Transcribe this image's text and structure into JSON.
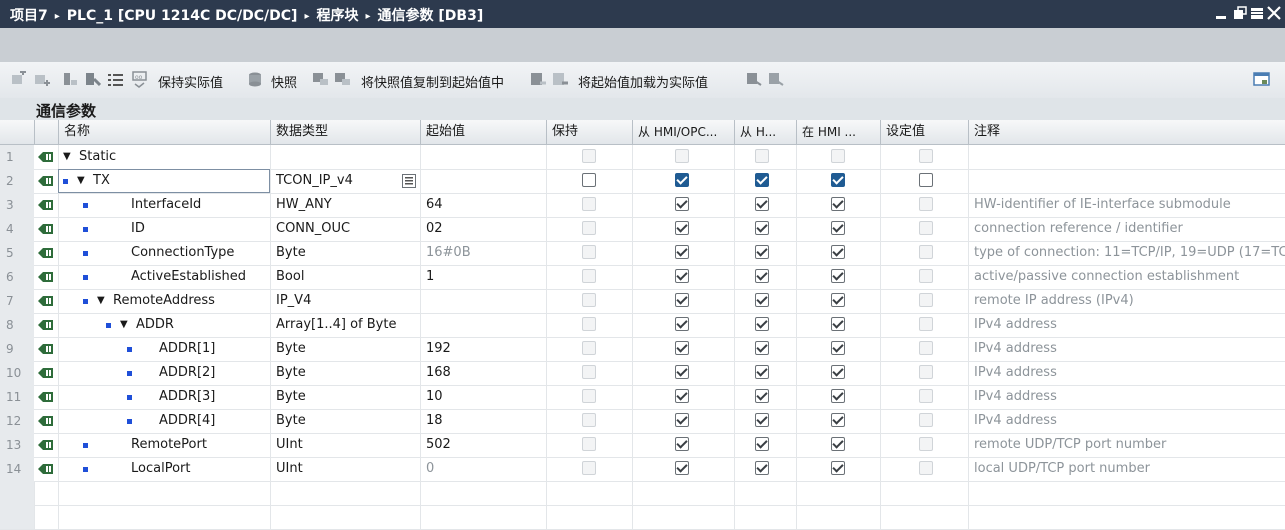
{
  "titlebar": {
    "project": "项目7",
    "plc": "PLC_1 [CPU 1214C DC/DC/DC]",
    "folder": "程序块",
    "block": "通信参数 [DB3]",
    "separator": "▸"
  },
  "toolbar": {
    "keep_actual": "保持实际值",
    "snapshot": "快照",
    "copy_snapshot": "将快照值复制到起始值中",
    "load_start": "将起始值加载为实际值"
  },
  "block_title": "通信参数",
  "columns": {
    "name": "名称",
    "type": "数据类型",
    "start": "起始值",
    "retain": "保持",
    "from_hmi": "从 HMI/OPC...",
    "from_h": "从 H...",
    "in_hmi": "在 HMI ...",
    "setpoint": "设定值",
    "comment": "注释"
  },
  "rows": [
    {
      "num": "1",
      "name": "Static",
      "type": "",
      "start": "",
      "comment": ""
    },
    {
      "num": "2",
      "name": "TX",
      "type": "TCON_IP_v4",
      "start": "",
      "comment": ""
    },
    {
      "num": "3",
      "name": "InterfaceId",
      "type": "HW_ANY",
      "start": "64",
      "comment": "HW-identifier of IE-interface submodule"
    },
    {
      "num": "4",
      "name": "ID",
      "type": "CONN_OUC",
      "start": "02",
      "comment": "connection reference / identifier"
    },
    {
      "num": "5",
      "name": "ConnectionType",
      "type": "Byte",
      "start": "16#0B",
      "comment": "type of connection: 11=TCP/IP, 19=UDP (17=TC"
    },
    {
      "num": "6",
      "name": "ActiveEstablished",
      "type": "Bool",
      "start": "1",
      "comment": "active/passive connection establishment"
    },
    {
      "num": "7",
      "name": "RemoteAddress",
      "type": "IP_V4",
      "start": "",
      "comment": "remote IP address (IPv4)"
    },
    {
      "num": "8",
      "name": "ADDR",
      "type": "Array[1..4] of Byte",
      "start": "",
      "comment": "IPv4 address"
    },
    {
      "num": "9",
      "name": "ADDR[1]",
      "type": "Byte",
      "start": "192",
      "comment": "IPv4 address"
    },
    {
      "num": "10",
      "name": "ADDR[2]",
      "type": "Byte",
      "start": "168",
      "comment": "IPv4 address"
    },
    {
      "num": "11",
      "name": "ADDR[3]",
      "type": "Byte",
      "start": "10",
      "comment": "IPv4 address"
    },
    {
      "num": "12",
      "name": "ADDR[4]",
      "type": "Byte",
      "start": "18",
      "comment": "IPv4 address"
    },
    {
      "num": "13",
      "name": "RemotePort",
      "type": "UInt",
      "start": "502",
      "comment": "remote UDP/TCP port number"
    },
    {
      "num": "14",
      "name": "LocalPort",
      "type": "UInt",
      "start": "0",
      "comment": "local UDP/TCP port number"
    }
  ],
  "colors": {
    "titlebar_bg": "#2d3a4e",
    "selection_blue": "#1f5b93",
    "member_dot": "#1f4fd8"
  },
  "icons": [
    "interface-static-icon",
    "expand-triangle-icon",
    "member-dot-icon",
    "checkbox-icon",
    "type-browse-icon",
    "minimize-icon",
    "restore-icon",
    "maximize-icon",
    "close-icon"
  ]
}
